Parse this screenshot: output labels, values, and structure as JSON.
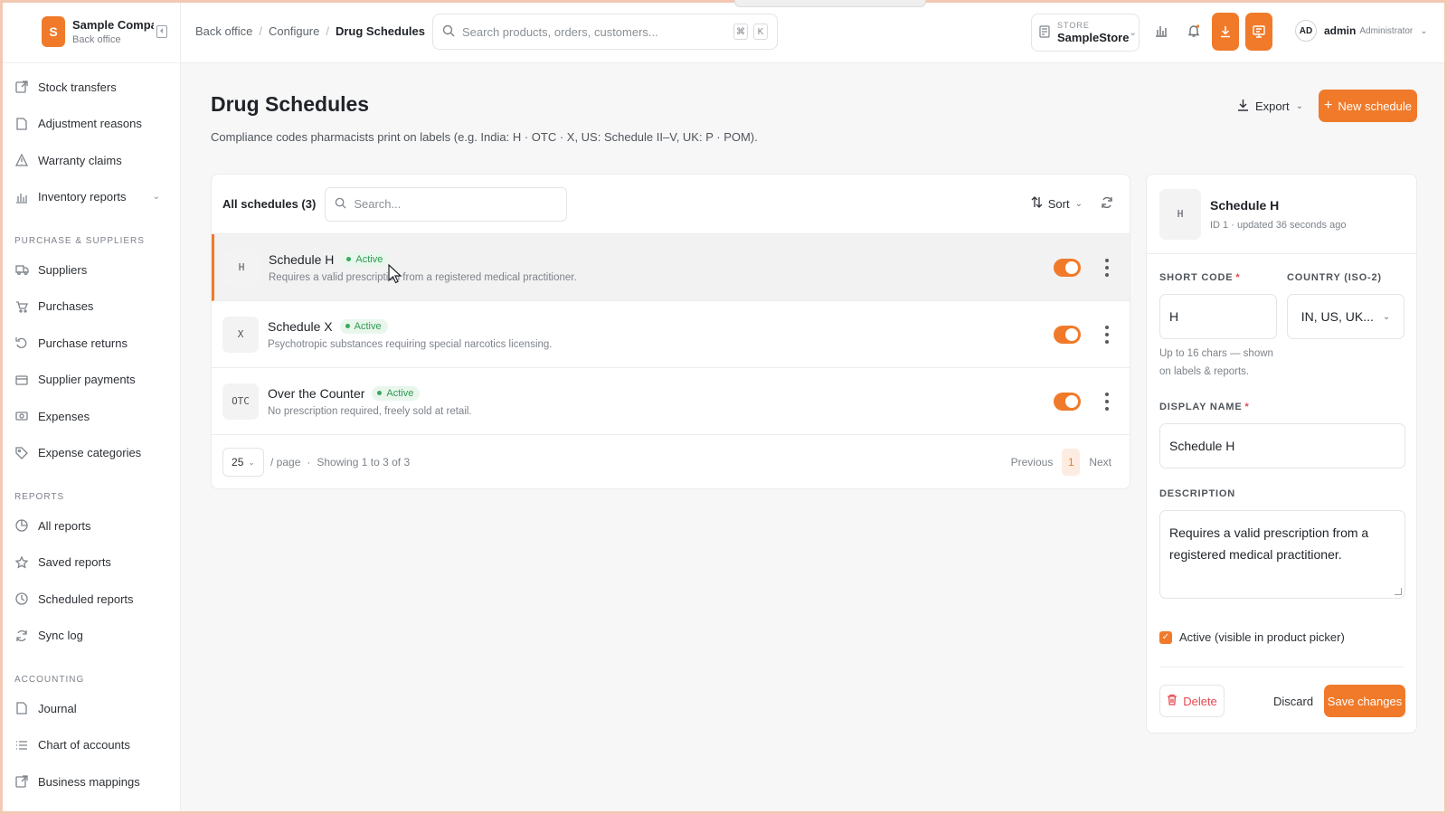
{
  "brand": {
    "name": "Sample Company",
    "subtitle": "Back office",
    "logo_letter": "S"
  },
  "sidebar": {
    "items_top": [
      {
        "label": "Stock transfers",
        "icon": "external-link-icon"
      },
      {
        "label": "Adjustment reasons",
        "icon": "document-icon"
      },
      {
        "label": "Warranty claims",
        "icon": "warning-icon"
      },
      {
        "label": "Inventory reports",
        "icon": "bar-chart-icon"
      }
    ],
    "section_purchase": "PURCHASE & SUPPLIERS",
    "items_purchase": [
      {
        "label": "Suppliers",
        "icon": "truck-icon"
      },
      {
        "label": "Purchases",
        "icon": "cart-icon"
      },
      {
        "label": "Purchase returns",
        "icon": "return-icon"
      },
      {
        "label": "Supplier payments",
        "icon": "wallet-icon"
      },
      {
        "label": "Expenses",
        "icon": "cash-icon"
      },
      {
        "label": "Expense categories",
        "icon": "tag-icon"
      }
    ],
    "section_reports": "REPORTS",
    "items_reports": [
      {
        "label": "All reports",
        "icon": "pie-chart-icon"
      },
      {
        "label": "Saved reports",
        "icon": "star-icon"
      },
      {
        "label": "Scheduled reports",
        "icon": "clock-icon"
      },
      {
        "label": "Sync log",
        "icon": "sync-icon"
      }
    ],
    "section_accounting": "ACCOUNTING",
    "items_accounting": [
      {
        "label": "Journal",
        "icon": "document-icon"
      },
      {
        "label": "Chart of accounts",
        "icon": "list-icon"
      },
      {
        "label": "Business mappings",
        "icon": "external-link-icon"
      }
    ]
  },
  "header": {
    "breadcrumb": [
      "Back office",
      "Configure",
      "Drug Schedules"
    ],
    "search_placeholder": "Search products, orders, customers...",
    "kbd1": "⌘",
    "kbd2": "K",
    "store_label": "STORE",
    "store_value": "SampleStore",
    "user_initials": "AD",
    "user_name": "admin",
    "user_role": "Administrator"
  },
  "page": {
    "title": "Drug Schedules",
    "subtitle": "Compliance codes pharmacists print on labels (e.g. India: H · OTC · X, US: Schedule II–V, UK: P · POM).",
    "export_label": "Export",
    "new_label": "New schedule"
  },
  "list": {
    "all_label": "All schedules (3)",
    "search_placeholder": "Search...",
    "sort_label": "Sort",
    "rows": [
      {
        "code": "H",
        "title": "Schedule H",
        "status": "Active",
        "desc": "Requires a valid prescription from a registered medical practitioner.",
        "enabled": true
      },
      {
        "code": "X",
        "title": "Schedule X",
        "status": "Active",
        "desc": "Psychotropic substances requiring special narcotics licensing.",
        "enabled": true
      },
      {
        "code": "OTC",
        "title": "Over the Counter",
        "status": "Active",
        "desc": "No prescription required, freely sold at retail.",
        "enabled": true
      }
    ],
    "per_page": "25",
    "per_page_label": "/ page",
    "showing": "Showing 1 to 3 of 3",
    "prev_label": "Previous",
    "page": "1",
    "next_label": "Next"
  },
  "detail": {
    "code": "H",
    "title": "Schedule H",
    "meta": "ID 1 · updated 36 seconds ago",
    "short_code_label": "SHORT CODE",
    "short_code_value": "H",
    "country_label": "COUNTRY (ISO-2)",
    "country_value": "IN, US, UK...",
    "short_code_hint": "Up to 16 chars — shown on labels & reports.",
    "display_name_label": "DISPLAY NAME",
    "display_name_value": "Schedule H",
    "description_label": "DESCRIPTION",
    "description_value": "Requires a valid prescription from a registered medical practitioner.",
    "active_label": "Active (visible in product picker)",
    "delete_label": "Delete",
    "discard_label": "Discard",
    "save_label": "Save changes"
  },
  "colors": {
    "accent": "#f07a2a",
    "active_green": "#2f9a52",
    "danger": "#e5484d"
  }
}
